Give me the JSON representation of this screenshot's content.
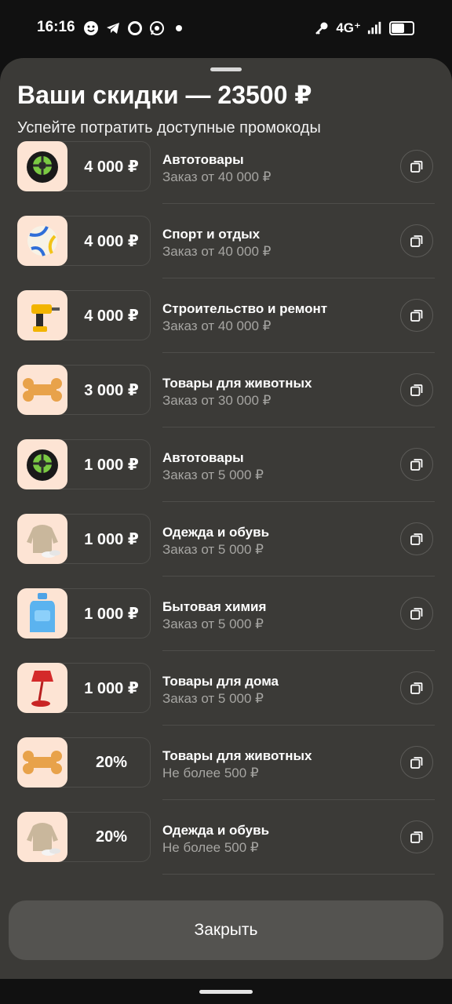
{
  "status_bar": {
    "time": "16:16",
    "network": "4G⁺"
  },
  "sheet": {
    "title": "Ваши скидки — 23500 ₽",
    "subtitle": "Успейте потратить доступные промокоды"
  },
  "items": [
    {
      "amount": "4 000 ₽",
      "category": "Автотовары",
      "condition": "Заказ от 40 000 ₽",
      "image": "tire-icon"
    },
    {
      "amount": "4 000 ₽",
      "category": "Спорт и отдых",
      "condition": "Заказ от 40 000 ₽",
      "image": "volleyball-icon"
    },
    {
      "amount": "4 000 ₽",
      "category": "Строительство и ремонт",
      "condition": "Заказ от 40 000 ₽",
      "image": "drill-icon"
    },
    {
      "amount": "3 000 ₽",
      "category": "Товары для животных",
      "condition": "Заказ от 30 000 ₽",
      "image": "bone-icon"
    },
    {
      "amount": "1 000 ₽",
      "category": "Автотовары",
      "condition": "Заказ от 5 000 ₽",
      "image": "tire-icon"
    },
    {
      "amount": "1 000 ₽",
      "category": "Одежда и обувь",
      "condition": "Заказ от 5 000 ₽",
      "image": "hoodie-icon"
    },
    {
      "amount": "1 000 ₽",
      "category": "Бытовая химия",
      "condition": "Заказ от 5 000 ₽",
      "image": "detergent-icon"
    },
    {
      "amount": "1 000 ₽",
      "category": "Товары для дома",
      "condition": "Заказ от 5 000 ₽",
      "image": "lamp-icon"
    },
    {
      "amount": "20%",
      "category": "Товары для животных",
      "condition": "Не более 500 ₽",
      "image": "bone-icon"
    },
    {
      "amount": "20%",
      "category": "Одежда и обувь",
      "condition": "Не более 500 ₽",
      "image": "hoodie-icon"
    }
  ],
  "close_button": {
    "label": "Закрыть"
  },
  "colors": {
    "sheet_bg": "#3b3a37",
    "thumb_bg": "#fde4d4",
    "muted_text": "#a6a5a2",
    "button_bg": "#545350"
  }
}
